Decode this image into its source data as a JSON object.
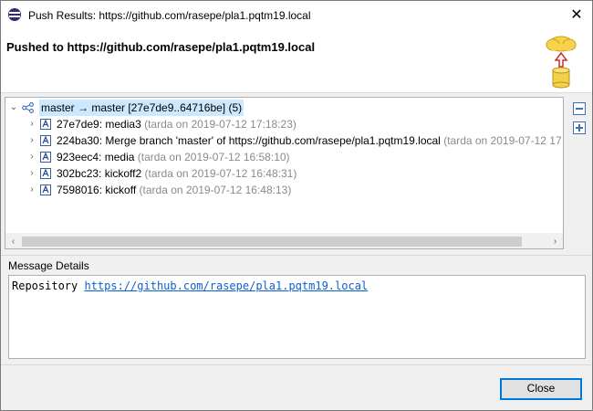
{
  "window": {
    "title": "Push Results: https://github.com/rasepe/pla1.pqtm19.local",
    "close_glyph": "✕"
  },
  "header": {
    "headline": "Pushed to https://github.com/rasepe/pla1.pqtm19.local",
    "graphic_icon": "push-to-cloud-icon"
  },
  "tree": {
    "root": {
      "label": "master → master [27e7de9..64716be] (5)",
      "icon": "branch-icon",
      "expanded": true
    },
    "commits": [
      {
        "id": "27e7de9",
        "message": "media3",
        "detail": "(tarda on 2019-07-12 17:18:23)"
      },
      {
        "id": "224ba30",
        "message": "Merge branch 'master' of https://github.com/rasepe/pla1.pqtm19.local",
        "detail": "(tarda on 2019-07-12 17"
      },
      {
        "id": "923eec4",
        "message": "media",
        "detail": "(tarda on 2019-07-12 16:58:10)"
      },
      {
        "id": "302bc23",
        "message": "kickoff2",
        "detail": "(tarda on 2019-07-12 16:48:31)"
      },
      {
        "id": "7598016",
        "message": "kickoff",
        "detail": "(tarda on 2019-07-12 16:48:13)"
      }
    ],
    "scroll_left": "‹",
    "scroll_right": "›"
  },
  "message_details": {
    "label": "Message Details",
    "prefix": "Repository",
    "link": "https://github.com/rasepe/pla1.pqtm19.local"
  },
  "footer": {
    "close_label": "Close"
  },
  "colors": {
    "selection": "#cce8ff",
    "link": "#0b5fd5",
    "accent": "#0078d7",
    "detail_text": "#8a8a8a"
  }
}
